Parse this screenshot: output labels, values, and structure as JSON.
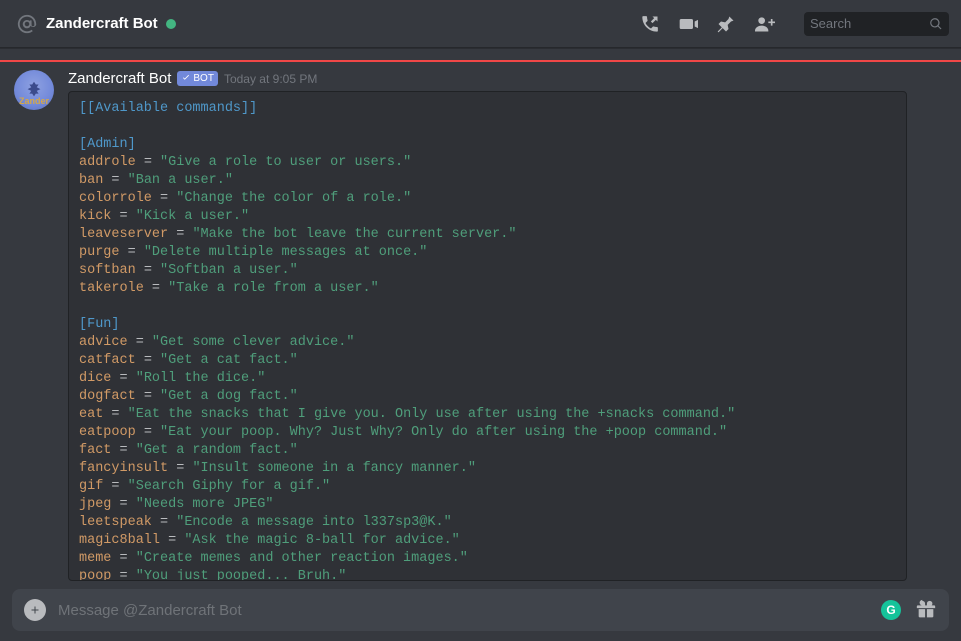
{
  "header": {
    "title": "Zandercraft Bot",
    "search_placeholder": "Search"
  },
  "message": {
    "author": "Zandercraft Bot",
    "bot_label": "BOT",
    "timestamp": "Today at 9:05 PM",
    "avatar_text": "Zander"
  },
  "code": {
    "title": "[[Available commands]]",
    "sections": [
      {
        "heading": "[Admin]",
        "lines": [
          {
            "key": "addrole",
            "val": "\"Give a role to user or users.\""
          },
          {
            "key": "ban",
            "val": "\"Ban a user.\""
          },
          {
            "key": "colorrole",
            "val": "\"Change the color of a role.\""
          },
          {
            "key": "kick",
            "val": "\"Kick a user.\""
          },
          {
            "key": "leaveserver",
            "val": "\"Make the bot leave the current server.\""
          },
          {
            "key": "purge",
            "val": "\"Delete multiple messages at once.\""
          },
          {
            "key": "softban",
            "val": "\"Softban a user.\""
          },
          {
            "key": "takerole",
            "val": "\"Take a role from a user.\""
          }
        ]
      },
      {
        "heading": "[Fun]",
        "lines": [
          {
            "key": "advice",
            "val": "\"Get some clever advice.\""
          },
          {
            "key": "catfact",
            "val": "\"Get a cat fact.\""
          },
          {
            "key": "dice",
            "val": "\"Roll the dice.\""
          },
          {
            "key": "dogfact",
            "val": "\"Get a dog fact.\""
          },
          {
            "key": "eat",
            "val": "\"Eat the snacks that I give you. Only use after using the +snacks command.\""
          },
          {
            "key": "eatpoop",
            "val": "\"Eat your poop. Why? Just Why? Only do after using the +poop command.\""
          },
          {
            "key": "fact",
            "val": "\"Get a random fact.\""
          },
          {
            "key": "fancyinsult",
            "val": "\"Insult someone in a fancy manner.\""
          },
          {
            "key": "gif",
            "val": "\"Search Giphy for a gif.\""
          },
          {
            "key": "jpeg",
            "val": "\"Needs more JPEG\""
          },
          {
            "key": "leetspeak",
            "val": "\"Encode a message into l337sp3@K.\""
          },
          {
            "key": "magic8ball",
            "val": "\"Ask the magic 8-ball for advice.\""
          },
          {
            "key": "meme",
            "val": "\"Create memes and other reaction images.\""
          },
          {
            "key": "poop",
            "val": "\"You just pooped... Bruh.\""
          }
        ]
      }
    ]
  },
  "composer": {
    "placeholder": "Message @Zandercraft Bot",
    "grammarly_letter": "G"
  }
}
